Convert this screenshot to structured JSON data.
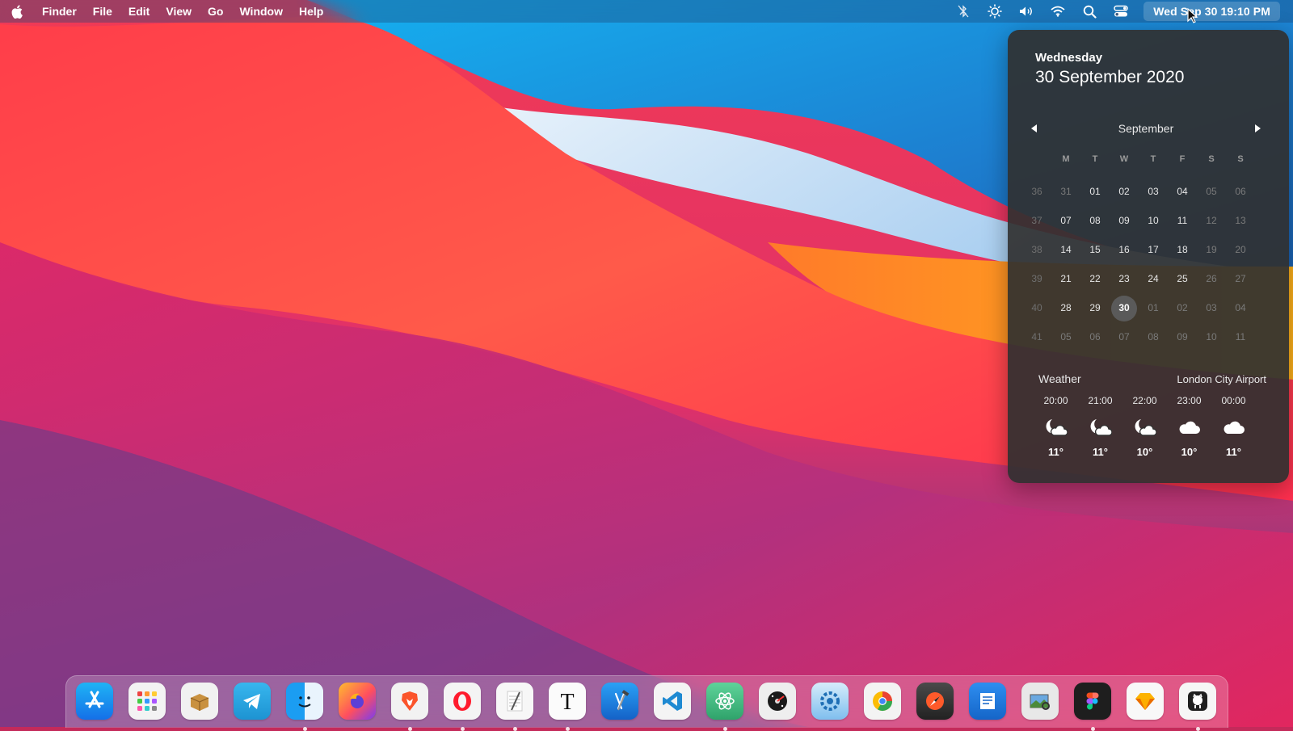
{
  "menubar": {
    "app_name": "Finder",
    "menus": [
      "File",
      "Edit",
      "View",
      "Go",
      "Window",
      "Help"
    ],
    "clock": "Wed Sep 30  19:10 PM",
    "status_icons": [
      "bluetooth-off-icon",
      "brightness-icon",
      "volume-icon",
      "wifi-icon",
      "search-icon",
      "control-center-icon"
    ]
  },
  "calendar": {
    "weekday": "Wednesday",
    "date": "30 September 2020",
    "month": "September",
    "weekday_headers": [
      "M",
      "T",
      "W",
      "T",
      "F",
      "S",
      "S"
    ],
    "weeks": [
      {
        "wk": "36",
        "days": [
          "31",
          "01",
          "02",
          "03",
          "04",
          "05",
          "06"
        ]
      },
      {
        "wk": "37",
        "days": [
          "07",
          "08",
          "09",
          "10",
          "11",
          "12",
          "13"
        ]
      },
      {
        "wk": "38",
        "days": [
          "14",
          "15",
          "16",
          "17",
          "18",
          "19",
          "20"
        ]
      },
      {
        "wk": "39",
        "days": [
          "21",
          "22",
          "23",
          "24",
          "25",
          "26",
          "27"
        ]
      },
      {
        "wk": "40",
        "days": [
          "28",
          "29",
          "30",
          "01",
          "02",
          "03",
          "04"
        ]
      },
      {
        "wk": "41",
        "days": [
          "05",
          "06",
          "07",
          "08",
          "09",
          "10",
          "11"
        ]
      }
    ],
    "today": "30"
  },
  "weather": {
    "title": "Weather",
    "location": "London City Airport",
    "hours": [
      {
        "time": "20:00",
        "icon": "moon-cloud-icon",
        "temp": "11°"
      },
      {
        "time": "21:00",
        "icon": "moon-cloud-icon",
        "temp": "11°"
      },
      {
        "time": "22:00",
        "icon": "moon-cloud-icon",
        "temp": "10°"
      },
      {
        "time": "23:00",
        "icon": "cloud-icon",
        "temp": "10°"
      },
      {
        "time": "00:00",
        "icon": "cloud-icon",
        "temp": "11°"
      }
    ]
  },
  "dock": {
    "apps": [
      {
        "name": "app-store-icon",
        "running": false
      },
      {
        "name": "launchpad-icon",
        "running": false
      },
      {
        "name": "archive-utility-icon",
        "running": false
      },
      {
        "name": "telegram-icon",
        "running": false
      },
      {
        "name": "finder-icon",
        "running": true
      },
      {
        "name": "firefox-icon",
        "running": false
      },
      {
        "name": "brave-icon",
        "running": true
      },
      {
        "name": "opera-icon",
        "running": true
      },
      {
        "name": "textedit-icon",
        "running": true
      },
      {
        "name": "typora-icon",
        "running": true
      },
      {
        "name": "xcode-icon",
        "running": false
      },
      {
        "name": "vscode-icon",
        "running": false
      },
      {
        "name": "atom-icon",
        "running": true
      },
      {
        "name": "disk-utility-icon",
        "running": false
      },
      {
        "name": "system-toolkit-icon",
        "running": false
      },
      {
        "name": "chrome-canary-icon",
        "running": false
      },
      {
        "name": "safari-tech-preview-icon",
        "running": false
      },
      {
        "name": "pages-icon",
        "running": false
      },
      {
        "name": "preview-icon",
        "running": false
      },
      {
        "name": "figma-icon",
        "running": true
      },
      {
        "name": "sketch-icon",
        "running": false
      },
      {
        "name": "github-desktop-icon",
        "running": true
      }
    ]
  }
}
